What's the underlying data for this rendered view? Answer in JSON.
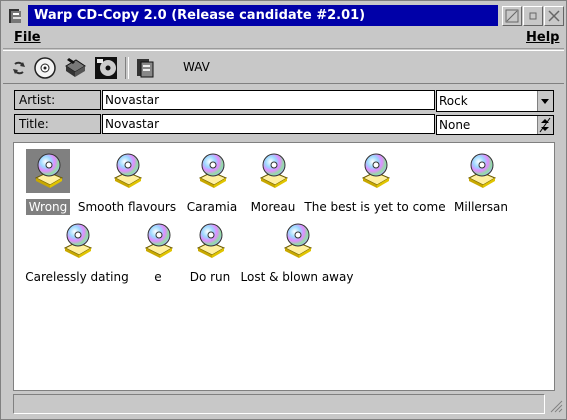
{
  "window": {
    "title": "Warp CD-Copy 2.0 (Release candidate #2.01)"
  },
  "menubar": {
    "file": "File",
    "help": "Help"
  },
  "toolbar": {
    "format_label": "WAV"
  },
  "fields": {
    "artist_label": "Artist:",
    "artist_value": "Novastar",
    "title_label": "Title:",
    "title_value": "Novastar",
    "genre": "Rock",
    "subgenre": "None"
  },
  "tracks": [
    {
      "name": "Wrong",
      "selected": true
    },
    {
      "name": "Smooth flavours",
      "selected": false
    },
    {
      "name": "Caramia",
      "selected": false
    },
    {
      "name": "Moreau",
      "selected": false
    },
    {
      "name": "The best is yet to come",
      "selected": false
    },
    {
      "name": "Millersan",
      "selected": false
    },
    {
      "name": "Carelessly dating",
      "selected": false
    },
    {
      "name": "e",
      "selected": false
    },
    {
      "name": "Do run",
      "selected": false
    },
    {
      "name": "Lost & blown away",
      "selected": false
    }
  ],
  "icons": {
    "system_menu": "cd-copy-app-icon",
    "toolbar": [
      "refresh-icon",
      "cd-icon",
      "eject-cd-icon",
      "cd-burn-icon",
      "copy-icon"
    ],
    "track": "cd-track-icon",
    "title_buttons": [
      "minimize-icon",
      "restore-icon",
      "close-icon"
    ]
  }
}
